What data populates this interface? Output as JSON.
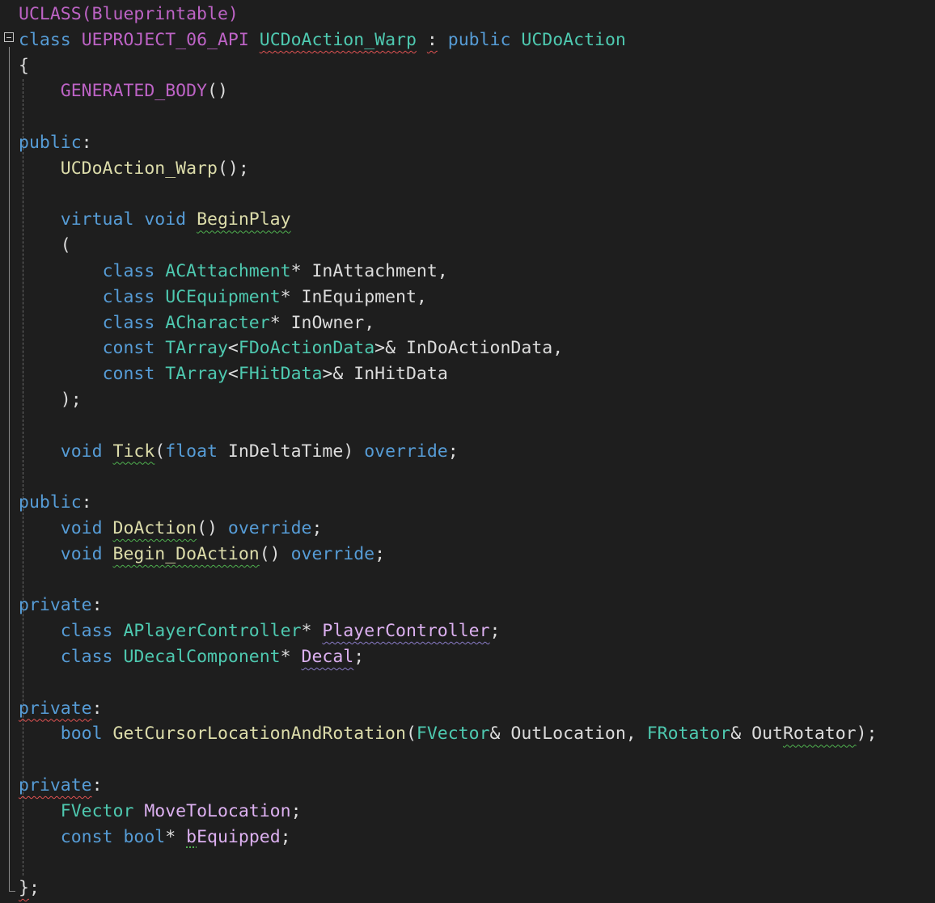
{
  "editor": {
    "language": "cpp",
    "colors": {
      "background": "#1e1e1e",
      "keyword": "#569cd6",
      "type": "#4ec9b0",
      "macro": "#bd63c5",
      "function": "#dcdcaa",
      "field": "#dcb0f0",
      "text": "#dcdcdc"
    },
    "lines": [
      [
        {
          "t": "UCLASS(Blueprintable)",
          "c": "macro"
        }
      ],
      [
        {
          "t": "class",
          "c": "kw"
        },
        {
          "t": " ",
          "c": "plain"
        },
        {
          "t": "UEPROJECT_06_API",
          "c": "api"
        },
        {
          "t": " ",
          "c": "plain"
        },
        {
          "t": "UCDoAction_Warp",
          "c": "type",
          "u": "squig-red"
        },
        {
          "t": " ",
          "c": "plain"
        },
        {
          "t": ":",
          "c": "plain",
          "u": "squig-red"
        },
        {
          "t": " ",
          "c": "plain"
        },
        {
          "t": "public",
          "c": "kw"
        },
        {
          "t": " ",
          "c": "plain"
        },
        {
          "t": "UCDoAction",
          "c": "type"
        }
      ],
      [
        {
          "t": "{",
          "c": "plain"
        }
      ],
      [
        {
          "t": "    ",
          "c": "plain"
        },
        {
          "t": "GENERATED_BODY",
          "c": "macro"
        },
        {
          "t": "()",
          "c": "plain"
        }
      ],
      [],
      [
        {
          "t": "public",
          "c": "kw"
        },
        {
          "t": ":",
          "c": "plain"
        }
      ],
      [
        {
          "t": "    ",
          "c": "plain"
        },
        {
          "t": "UCDoAction_Warp",
          "c": "fn"
        },
        {
          "t": "();",
          "c": "plain"
        }
      ],
      [],
      [
        {
          "t": "    ",
          "c": "plain"
        },
        {
          "t": "virtual",
          "c": "kw"
        },
        {
          "t": " ",
          "c": "plain"
        },
        {
          "t": "void",
          "c": "kw"
        },
        {
          "t": " ",
          "c": "plain"
        },
        {
          "t": "BeginPlay",
          "c": "fn",
          "u": "squig-green"
        }
      ],
      [
        {
          "t": "    (",
          "c": "plain"
        }
      ],
      [
        {
          "t": "        ",
          "c": "plain"
        },
        {
          "t": "class",
          "c": "kw"
        },
        {
          "t": " ",
          "c": "plain"
        },
        {
          "t": "ACAttachment",
          "c": "type"
        },
        {
          "t": "* InAttachment,",
          "c": "plain"
        }
      ],
      [
        {
          "t": "        ",
          "c": "plain"
        },
        {
          "t": "class",
          "c": "kw"
        },
        {
          "t": " ",
          "c": "plain"
        },
        {
          "t": "UCEquipment",
          "c": "type"
        },
        {
          "t": "* InEquipment,",
          "c": "plain"
        }
      ],
      [
        {
          "t": "        ",
          "c": "plain"
        },
        {
          "t": "class",
          "c": "kw"
        },
        {
          "t": " ",
          "c": "plain"
        },
        {
          "t": "ACharacter",
          "c": "type"
        },
        {
          "t": "* InOwner,",
          "c": "plain"
        }
      ],
      [
        {
          "t": "        ",
          "c": "plain"
        },
        {
          "t": "const",
          "c": "kw"
        },
        {
          "t": " ",
          "c": "plain"
        },
        {
          "t": "TArray",
          "c": "type"
        },
        {
          "t": "<",
          "c": "plain"
        },
        {
          "t": "FDoActionData",
          "c": "type"
        },
        {
          "t": ">& InDoActionData,",
          "c": "plain"
        }
      ],
      [
        {
          "t": "        ",
          "c": "plain"
        },
        {
          "t": "const",
          "c": "kw"
        },
        {
          "t": " ",
          "c": "plain"
        },
        {
          "t": "TArray",
          "c": "type"
        },
        {
          "t": "<",
          "c": "plain"
        },
        {
          "t": "FHitData",
          "c": "type"
        },
        {
          "t": ">& InHitData",
          "c": "plain"
        }
      ],
      [
        {
          "t": "    );",
          "c": "plain"
        }
      ],
      [],
      [
        {
          "t": "    ",
          "c": "plain"
        },
        {
          "t": "void",
          "c": "kw"
        },
        {
          "t": " ",
          "c": "plain"
        },
        {
          "t": "Tick",
          "c": "fn",
          "u": "squig-green"
        },
        {
          "t": "(",
          "c": "plain"
        },
        {
          "t": "float",
          "c": "kw"
        },
        {
          "t": " InDeltaTime) ",
          "c": "plain"
        },
        {
          "t": "override",
          "c": "kw"
        },
        {
          "t": ";",
          "c": "plain"
        }
      ],
      [],
      [
        {
          "t": "public",
          "c": "kw"
        },
        {
          "t": ":",
          "c": "plain"
        }
      ],
      [
        {
          "t": "    ",
          "c": "plain"
        },
        {
          "t": "void",
          "c": "kw"
        },
        {
          "t": " ",
          "c": "plain"
        },
        {
          "t": "DoAction",
          "c": "fn",
          "u": "squig-green"
        },
        {
          "t": "() ",
          "c": "plain"
        },
        {
          "t": "override",
          "c": "kw"
        },
        {
          "t": ";",
          "c": "plain"
        }
      ],
      [
        {
          "t": "    ",
          "c": "plain"
        },
        {
          "t": "void",
          "c": "kw"
        },
        {
          "t": " ",
          "c": "plain"
        },
        {
          "t": "Begin_DoAction",
          "c": "fn",
          "u": "squig-green"
        },
        {
          "t": "() ",
          "c": "plain"
        },
        {
          "t": "override",
          "c": "kw"
        },
        {
          "t": ";",
          "c": "plain"
        }
      ],
      [],
      [
        {
          "t": "private",
          "c": "kw"
        },
        {
          "t": ":",
          "c": "plain"
        }
      ],
      [
        {
          "t": "    ",
          "c": "plain"
        },
        {
          "t": "class",
          "c": "kw"
        },
        {
          "t": " ",
          "c": "plain"
        },
        {
          "t": "APlayerController",
          "c": "type"
        },
        {
          "t": "* ",
          "c": "plain"
        },
        {
          "t": "PlayerController",
          "c": "field",
          "u": "squig-purple"
        },
        {
          "t": ";",
          "c": "plain"
        }
      ],
      [
        {
          "t": "    ",
          "c": "plain"
        },
        {
          "t": "class",
          "c": "kw"
        },
        {
          "t": " ",
          "c": "plain"
        },
        {
          "t": "UDecalComponent",
          "c": "type"
        },
        {
          "t": "* ",
          "c": "plain"
        },
        {
          "t": "Decal",
          "c": "field",
          "u": "squig-purple"
        },
        {
          "t": ";",
          "c": "plain"
        }
      ],
      [],
      [
        {
          "t": "private",
          "c": "kw",
          "u": "squig-red"
        },
        {
          "t": ":",
          "c": "plain"
        }
      ],
      [
        {
          "t": "    ",
          "c": "plain"
        },
        {
          "t": "bool",
          "c": "kw"
        },
        {
          "t": " ",
          "c": "plain"
        },
        {
          "t": "GetCursorLocationAndRotation",
          "c": "fn"
        },
        {
          "t": "(",
          "c": "plain"
        },
        {
          "t": "FVector",
          "c": "type"
        },
        {
          "t": "& OutLocation, ",
          "c": "plain"
        },
        {
          "t": "FRotator",
          "c": "type"
        },
        {
          "t": "& Out",
          "c": "plain"
        },
        {
          "t": "Rotator",
          "c": "plain",
          "u": "squig-green"
        },
        {
          "t": ");",
          "c": "plain"
        }
      ],
      [],
      [
        {
          "t": "private",
          "c": "kw",
          "u": "squig-red"
        },
        {
          "t": ":",
          "c": "plain"
        }
      ],
      [
        {
          "t": "    ",
          "c": "plain"
        },
        {
          "t": "FVector",
          "c": "type"
        },
        {
          "t": " ",
          "c": "plain"
        },
        {
          "t": "MoveToLocation",
          "c": "field"
        },
        {
          "t": ";",
          "c": "plain"
        }
      ],
      [
        {
          "t": "    ",
          "c": "plain"
        },
        {
          "t": "const",
          "c": "kw"
        },
        {
          "t": " ",
          "c": "plain"
        },
        {
          "t": "bool",
          "c": "kw"
        },
        {
          "t": "* ",
          "c": "plain"
        },
        {
          "t": "b",
          "c": "field",
          "u": "dotted-green"
        },
        {
          "t": "Equipped",
          "c": "field"
        },
        {
          "t": ";",
          "c": "plain"
        }
      ],
      [],
      [
        {
          "t": "}",
          "c": "plain",
          "u": "squig-red"
        },
        {
          "t": ";",
          "c": "plain"
        }
      ]
    ]
  }
}
